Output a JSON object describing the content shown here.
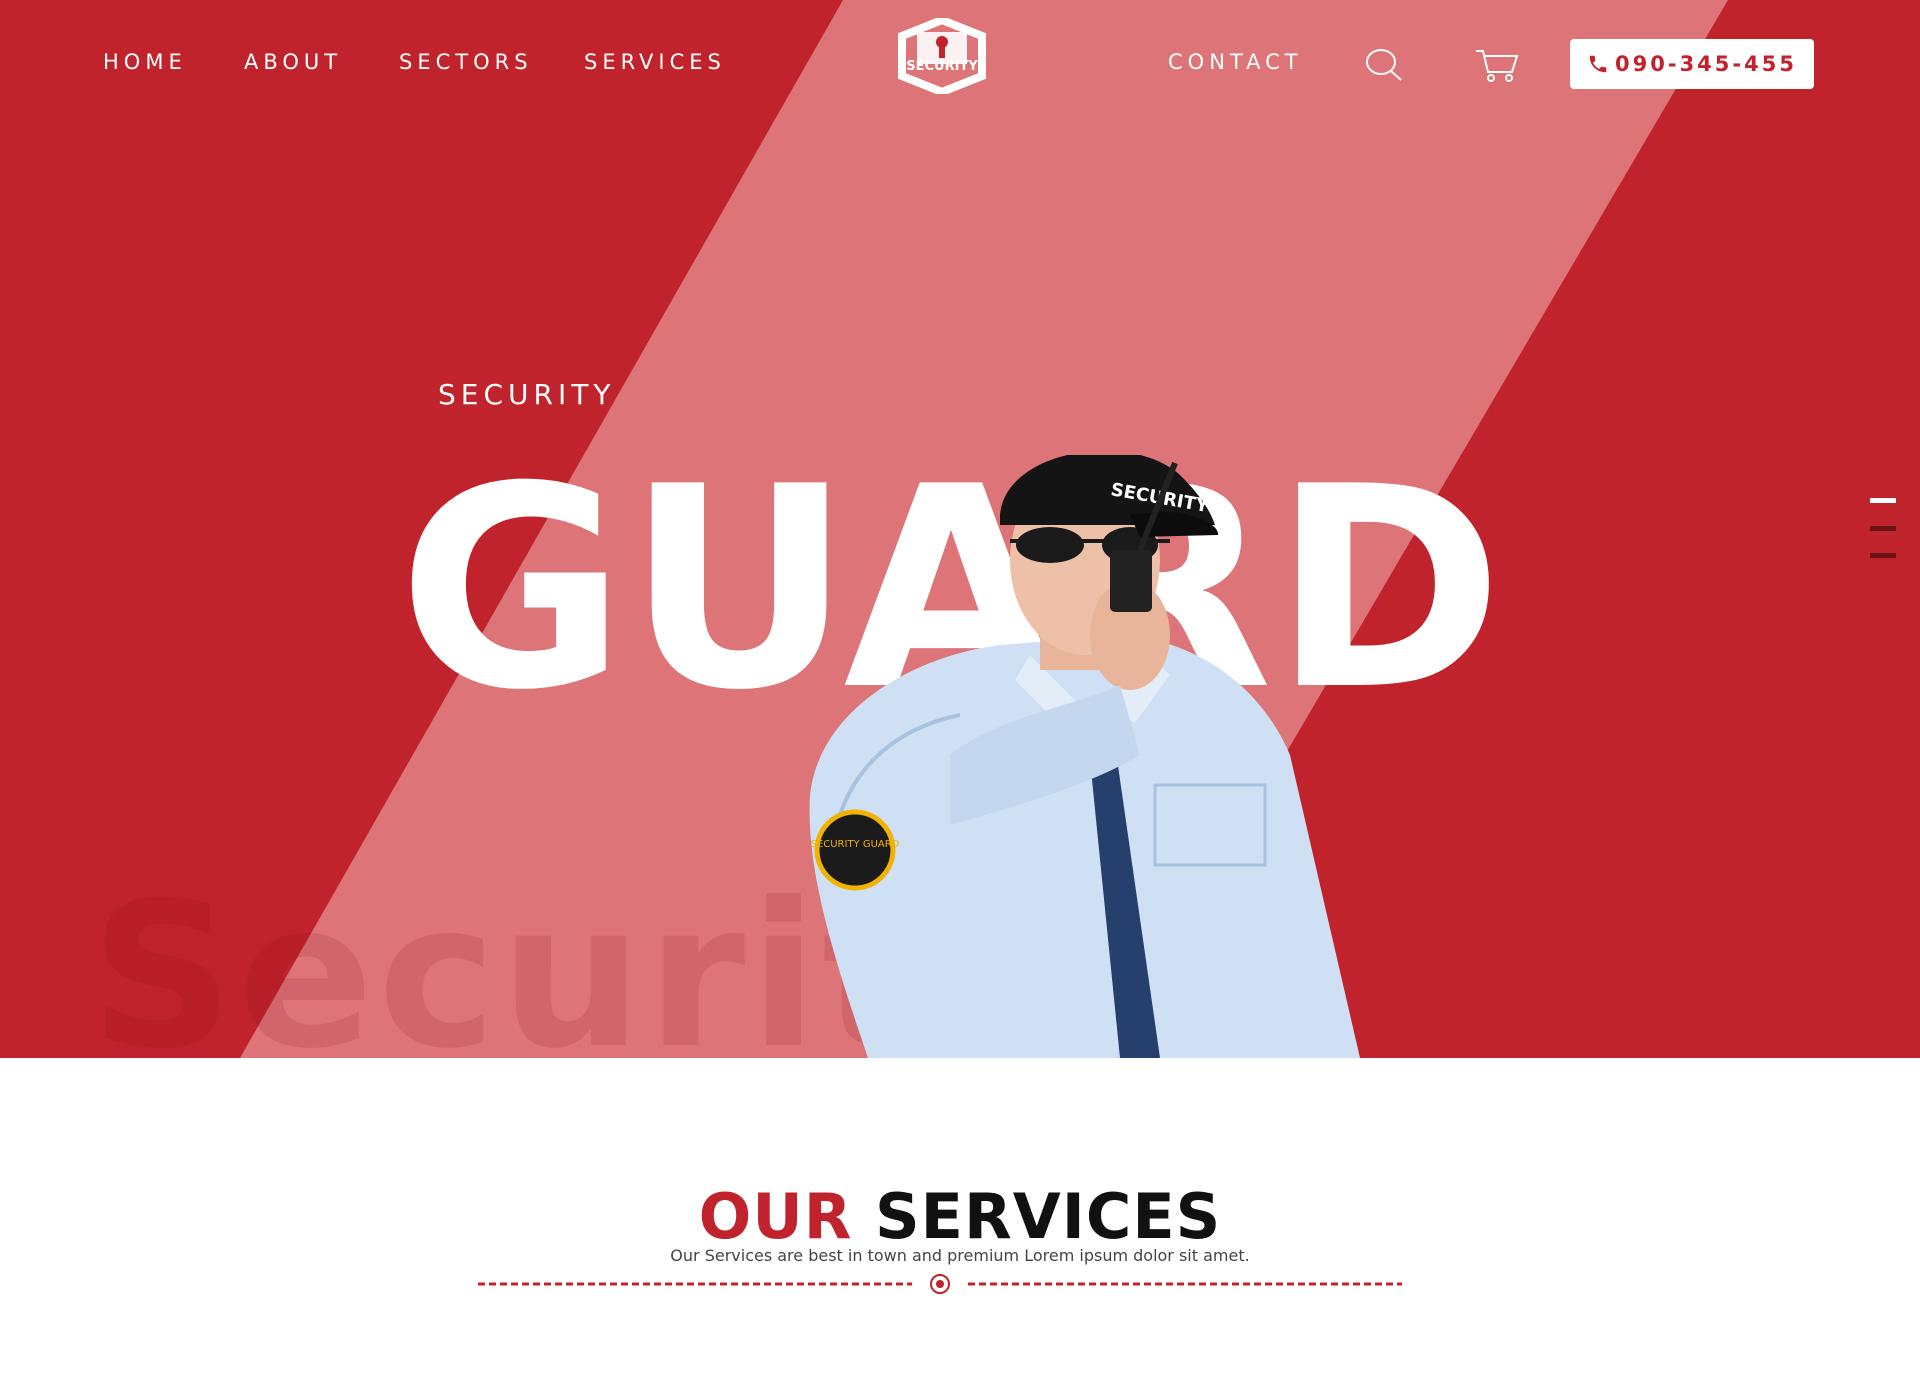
{
  "nav": {
    "home": "HOME",
    "about": "ABOUT",
    "sectors": "SECTORS",
    "services": "SERVICES",
    "contact": "CONTACT",
    "phone": "090-345-455"
  },
  "logo": {
    "text": "SECURITY"
  },
  "hero": {
    "kicker": "SECURITY",
    "headline": "GUARD",
    "watermark": "Security",
    "cap_text": "SECURITY",
    "badge_text": "SECURITY GUARD",
    "slider_active_index": 1,
    "slider_count": 3
  },
  "services": {
    "title_accent": "OUR",
    "title_rest": "SERVICES",
    "subtitle": "Our Services are best in town and premium Lorem ipsum dolor sit amet."
  },
  "colors": {
    "brand_red": "#c1232d",
    "band_pink": "#dc7478",
    "white": "#ffffff"
  },
  "icons": {
    "search": "search-icon",
    "cart": "cart-icon",
    "phone": "phone-icon",
    "logo": "shield-lock-icon"
  }
}
